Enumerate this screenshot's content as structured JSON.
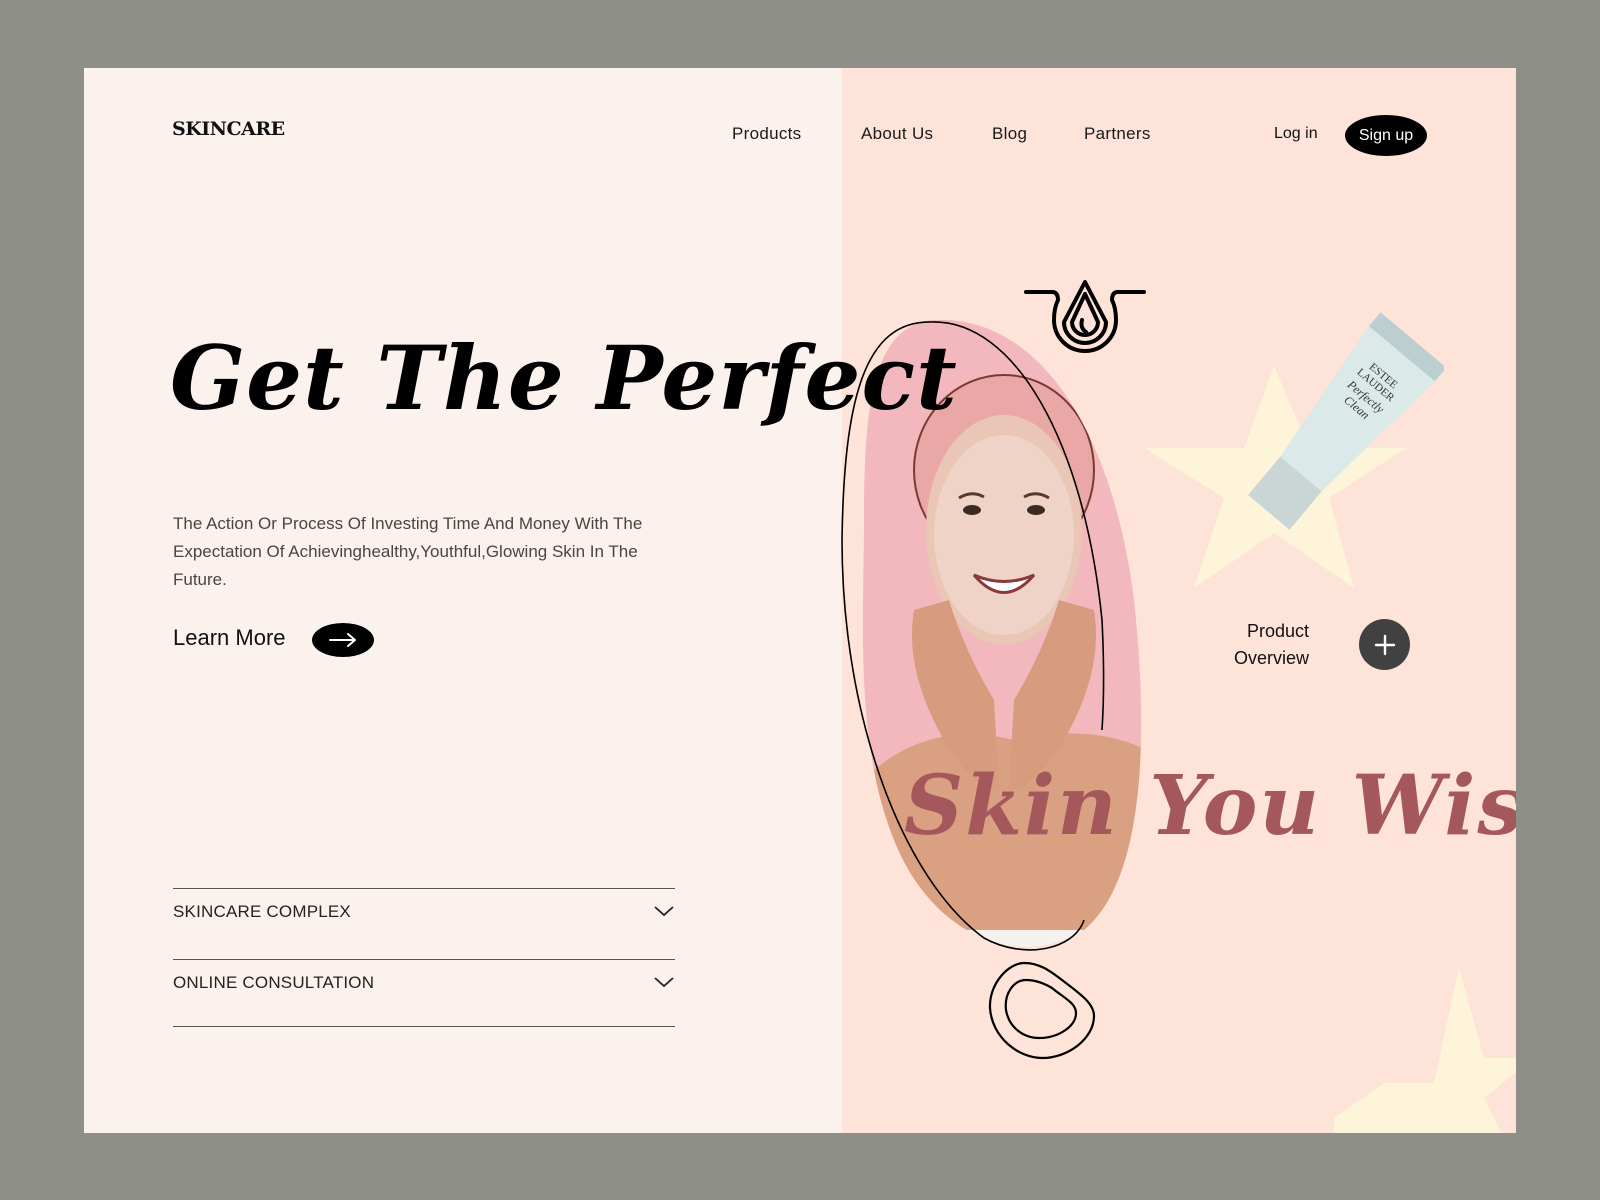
{
  "brand": {
    "logo": "SKINCARE"
  },
  "nav": {
    "items": [
      {
        "label": "Products"
      },
      {
        "label": "About Us"
      },
      {
        "label": "Blog"
      },
      {
        "label": "Partners"
      }
    ],
    "login_label": "Log in",
    "signup_label": "Sign up"
  },
  "hero": {
    "headline": "Get The Perfect",
    "headline_accent": "Skin You Wish",
    "description": "The Action Or Process Of Investing Time And Money With The Expectation Of Achievinghealthy,Youthful,Glowing Skin In The Future.",
    "cta_label": "Learn More",
    "cta_icon": "arrow-right-icon"
  },
  "accordion": {
    "items": [
      {
        "label": "SKINCARE COMPLEX",
        "icon": "chevron-down-icon"
      },
      {
        "label": "ONLINE CONSULTATION",
        "icon": "chevron-down-icon"
      }
    ]
  },
  "product": {
    "overview_line1": "Product",
    "overview_line2": "Overview",
    "icon": "plus-icon",
    "tube_brand_line1": "ESTEE",
    "tube_brand_line2": "LAUDER",
    "tube_name_line1": "Perfectly",
    "tube_name_line2": "Clean"
  },
  "colors": {
    "frame": "#8e8f89",
    "left_bg": "#fcf2ed",
    "right_bg": "#fde3d8",
    "accent_text": "#a5585c",
    "photo_bg": "#f2b8bd",
    "star": "#fdf4da",
    "button_dark": "#000000",
    "plus_button": "#414141"
  }
}
